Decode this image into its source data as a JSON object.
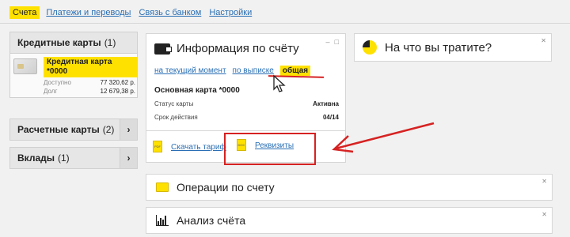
{
  "topnav": {
    "items": [
      "Счета",
      "Платежи и переводы",
      "Связь с банком",
      "Настройки"
    ]
  },
  "left": {
    "credit_cards": {
      "label": "Кредитные карты",
      "count": "(1)"
    },
    "card": {
      "name_line1": "Кредитная карта",
      "name_line2": "*0000",
      "available_label": "Доступно",
      "available_value": "77 320,62 р.",
      "debt_label": "Долг",
      "debt_value": "12 679,38 р."
    },
    "settlement_cards": {
      "label": "Расчетные карты",
      "count": "(2)"
    },
    "deposits": {
      "label": "Вклады",
      "count": "(1)"
    }
  },
  "info": {
    "title": "Информация по счёту",
    "tabs": [
      "на текущий момент",
      "по выписке",
      "общая"
    ],
    "main_card": "Основная карта  *0000",
    "status_label": "Статус карты",
    "status_value": "Активна",
    "expiry_label": "Срок действия",
    "expiry_value": "04/14",
    "download_label": "Скачать тариф",
    "requisites_label": "Реквизиты",
    "doc1_tag": "PDF",
    "doc2_tag": "DOC"
  },
  "spend": {
    "title": "На что вы тратите?"
  },
  "operations": {
    "title": "Операции по счету"
  },
  "analysis": {
    "title": "Анализ счёта"
  },
  "colors": {
    "accent": "#ffe100",
    "link": "#2a6fb5",
    "annotation": "#d62222"
  }
}
